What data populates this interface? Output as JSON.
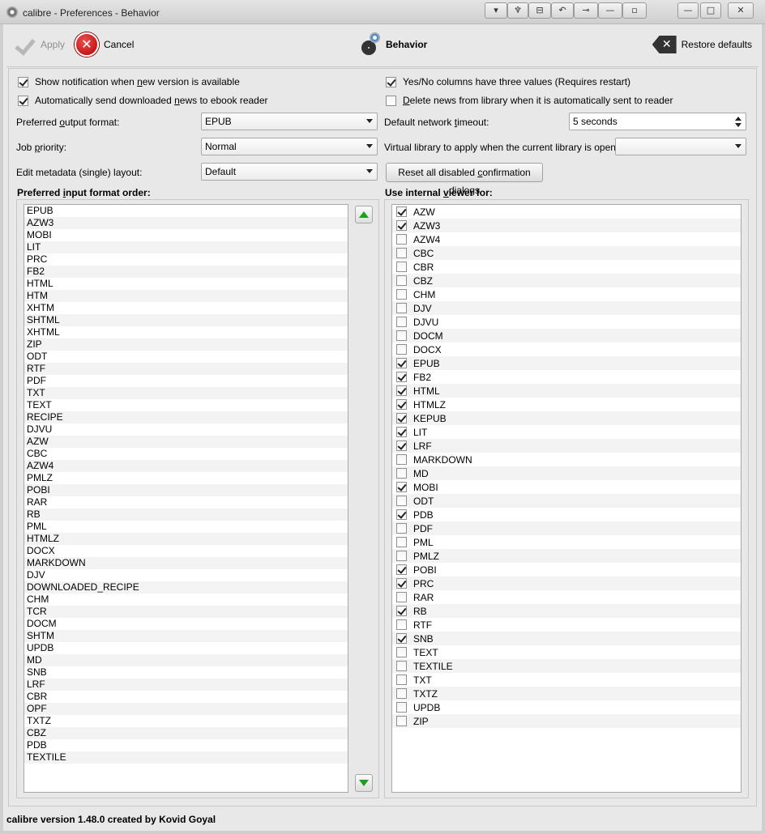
{
  "window": {
    "title": "calibre - Preferences - Behavior",
    "titlebar_buttons": [
      "▾",
      "♆",
      "⊟",
      "↶",
      "⊸",
      "—",
      "▫",
      "—",
      "□",
      "✕"
    ]
  },
  "toolbar": {
    "apply_label": "Apply",
    "cancel_label": "Cancel",
    "section_label": "Behavior",
    "restore_label": "Restore defaults"
  },
  "options": {
    "show_notification": {
      "checked": true,
      "pre": "Show notification when ",
      "u": "n",
      "post": "ew version is available"
    },
    "auto_send_news": {
      "checked": true,
      "pre": "Automatically send downloaded ",
      "u": "n",
      "post": "ews to ebook reader"
    },
    "yes_no_three": {
      "checked": true,
      "pre": "Yes/No columns have three values (Requires restart)",
      "u": "",
      "post": ""
    },
    "delete_news": {
      "checked": false,
      "pre": "",
      "u": "D",
      "post": "elete news from library when it is automatically sent to reader"
    }
  },
  "form": {
    "output_format": {
      "label_pre": "Preferred ",
      "label_u": "o",
      "label_post": "utput format:",
      "value": "EPUB"
    },
    "job_priority": {
      "label_pre": "Job ",
      "label_u": "p",
      "label_post": "riority:",
      "value": "Normal"
    },
    "edit_metadata": {
      "label": "Edit metadata (single) layout:",
      "value": "Default"
    },
    "network_timeout": {
      "label_pre": "Default network ",
      "label_u": "t",
      "label_post": "imeout:",
      "value": "5 seconds"
    },
    "virtual_library": {
      "label": "Virtual library to apply when the current library is opened:",
      "value": ""
    },
    "reset_dialogs": {
      "pre": "Reset all disabled ",
      "u": "c",
      "post": "onfirmation dialogs"
    }
  },
  "input_order": {
    "title_pre": "Preferred ",
    "title_u": "i",
    "title_post": "nput format order:",
    "items": [
      "EPUB",
      "AZW3",
      "MOBI",
      "LIT",
      "PRC",
      "FB2",
      "HTML",
      "HTM",
      "XHTM",
      "SHTML",
      "XHTML",
      "ZIP",
      "ODT",
      "RTF",
      "PDF",
      "TXT",
      "TEXT",
      "RECIPE",
      "DJVU",
      "AZW",
      "CBC",
      "AZW4",
      "PMLZ",
      "POBI",
      "RAR",
      "RB",
      "PML",
      "HTMLZ",
      "DOCX",
      "MARKDOWN",
      "DJV",
      "DOWNLOADED_RECIPE",
      "CHM",
      "TCR",
      "DOCM",
      "SHTM",
      "UPDB",
      "MD",
      "SNB",
      "LRF",
      "CBR",
      "OPF",
      "TXTZ",
      "CBZ",
      "PDB",
      "TEXTILE"
    ]
  },
  "internal_viewer": {
    "title_pre": "Use internal ",
    "title_u": "v",
    "title_post": "iewer for:",
    "items": [
      {
        "label": "AZW",
        "checked": true
      },
      {
        "label": "AZW3",
        "checked": true
      },
      {
        "label": "AZW4",
        "checked": false
      },
      {
        "label": "CBC",
        "checked": false
      },
      {
        "label": "CBR",
        "checked": false
      },
      {
        "label": "CBZ",
        "checked": false
      },
      {
        "label": "CHM",
        "checked": false
      },
      {
        "label": "DJV",
        "checked": false
      },
      {
        "label": "DJVU",
        "checked": false
      },
      {
        "label": "DOCM",
        "checked": false
      },
      {
        "label": "DOCX",
        "checked": false
      },
      {
        "label": "EPUB",
        "checked": true
      },
      {
        "label": "FB2",
        "checked": true
      },
      {
        "label": "HTML",
        "checked": true
      },
      {
        "label": "HTMLZ",
        "checked": true
      },
      {
        "label": "KEPUB",
        "checked": true
      },
      {
        "label": "LIT",
        "checked": true
      },
      {
        "label": "LRF",
        "checked": true
      },
      {
        "label": "MARKDOWN",
        "checked": false
      },
      {
        "label": "MD",
        "checked": false
      },
      {
        "label": "MOBI",
        "checked": true
      },
      {
        "label": "ODT",
        "checked": false
      },
      {
        "label": "PDB",
        "checked": true
      },
      {
        "label": "PDF",
        "checked": false
      },
      {
        "label": "PML",
        "checked": false
      },
      {
        "label": "PMLZ",
        "checked": false
      },
      {
        "label": "POBI",
        "checked": true
      },
      {
        "label": "PRC",
        "checked": true
      },
      {
        "label": "RAR",
        "checked": false
      },
      {
        "label": "RB",
        "checked": true
      },
      {
        "label": "RTF",
        "checked": false
      },
      {
        "label": "SNB",
        "checked": true
      },
      {
        "label": "TEXT",
        "checked": false
      },
      {
        "label": "TEXTILE",
        "checked": false
      },
      {
        "label": "TXT",
        "checked": false
      },
      {
        "label": "TXTZ",
        "checked": false
      },
      {
        "label": "UPDB",
        "checked": false
      },
      {
        "label": "ZIP",
        "checked": false
      }
    ]
  },
  "status": {
    "text": "calibre version 1.48.0 created by Kovid Goyal"
  },
  "colors": {
    "arrow_green": "#1aa01a",
    "cancel_red": "#c81e1e"
  }
}
